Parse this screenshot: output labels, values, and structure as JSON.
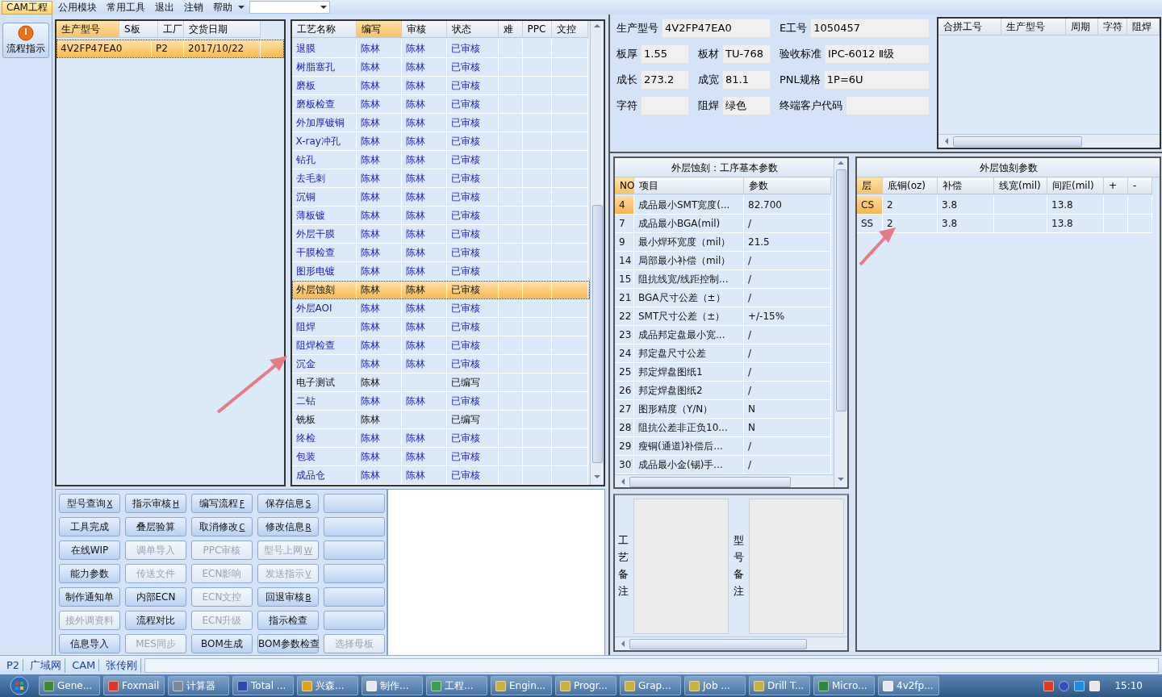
{
  "menu": {
    "items": [
      {
        "label": "CAM工程",
        "selected": true
      },
      {
        "label": "公用模块",
        "selected": false
      },
      {
        "label": "常用工具",
        "selected": false
      },
      {
        "label": "退出",
        "selected": false
      },
      {
        "label": "注销",
        "selected": false
      },
      {
        "label": "帮助",
        "selected": false
      }
    ]
  },
  "sidebar_button": {
    "label": "流程指示"
  },
  "orders": {
    "columns": [
      "生产型号",
      "S板",
      "工厂",
      "交货日期"
    ],
    "rows": [
      {
        "model": "4V2FP47EA0",
        "factory": "P2",
        "date": "2017/10/22",
        "selected": true
      }
    ]
  },
  "process": {
    "columns": [
      "工艺名称",
      "编写",
      "审核",
      "状态",
      "难",
      "PPC",
      "文控"
    ],
    "rows": [
      {
        "name": "退膜",
        "writer": "陈林",
        "reviewer": "陈林",
        "status": "已审核",
        "kind": "reviewed",
        "selected": false
      },
      {
        "name": "树脂塞孔",
        "writer": "陈林",
        "reviewer": "陈林",
        "status": "已审核",
        "kind": "reviewed",
        "selected": false
      },
      {
        "name": "磨板",
        "writer": "陈林",
        "reviewer": "陈林",
        "status": "已审核",
        "kind": "reviewed",
        "selected": false
      },
      {
        "name": "磨板检查",
        "writer": "陈林",
        "reviewer": "陈林",
        "status": "已审核",
        "kind": "reviewed",
        "selected": false
      },
      {
        "name": "外加厚镀铜",
        "writer": "陈林",
        "reviewer": "陈林",
        "status": "已审核",
        "kind": "reviewed",
        "selected": false
      },
      {
        "name": "X-ray冲孔",
        "writer": "陈林",
        "reviewer": "陈林",
        "status": "已审核",
        "kind": "reviewed",
        "selected": false
      },
      {
        "name": "钻孔",
        "writer": "陈林",
        "reviewer": "陈林",
        "status": "已审核",
        "kind": "reviewed",
        "selected": false
      },
      {
        "name": "去毛刺",
        "writer": "陈林",
        "reviewer": "陈林",
        "status": "已审核",
        "kind": "reviewed",
        "selected": false
      },
      {
        "name": "沉铜",
        "writer": "陈林",
        "reviewer": "陈林",
        "status": "已审核",
        "kind": "reviewed",
        "selected": false
      },
      {
        "name": "薄板镀",
        "writer": "陈林",
        "reviewer": "陈林",
        "status": "已审核",
        "kind": "reviewed",
        "selected": false
      },
      {
        "name": "外层干膜",
        "writer": "陈林",
        "reviewer": "陈林",
        "status": "已审核",
        "kind": "reviewed",
        "selected": false
      },
      {
        "name": "干膜检查",
        "writer": "陈林",
        "reviewer": "陈林",
        "status": "已审核",
        "kind": "reviewed",
        "selected": false
      },
      {
        "name": "图形电镀",
        "writer": "陈林",
        "reviewer": "陈林",
        "status": "已审核",
        "kind": "reviewed",
        "selected": false
      },
      {
        "name": "外层蚀刻",
        "writer": "陈林",
        "reviewer": "陈林",
        "status": "已审核",
        "kind": "reviewed",
        "selected": true
      },
      {
        "name": "外层AOI",
        "writer": "陈林",
        "reviewer": "陈林",
        "status": "已审核",
        "kind": "reviewed",
        "selected": false
      },
      {
        "name": "阻焊",
        "writer": "陈林",
        "reviewer": "陈林",
        "status": "已审核",
        "kind": "reviewed",
        "selected": false
      },
      {
        "name": "阻焊检查",
        "writer": "陈林",
        "reviewer": "陈林",
        "status": "已审核",
        "kind": "reviewed",
        "selected": false
      },
      {
        "name": "沉金",
        "writer": "陈林",
        "reviewer": "陈林",
        "status": "已审核",
        "kind": "reviewed",
        "selected": false
      },
      {
        "name": "电子测试",
        "writer": "陈林",
        "status": "已编写",
        "kind": "written",
        "selected": false
      },
      {
        "name": "二钻",
        "writer": "陈林",
        "reviewer": "陈林",
        "status": "已审核",
        "kind": "reviewed",
        "selected": false
      },
      {
        "name": "铣板",
        "writer": "陈林",
        "status": "已编写",
        "kind": "written",
        "selected": false
      },
      {
        "name": "终检",
        "writer": "陈林",
        "reviewer": "陈林",
        "status": "已审核",
        "kind": "reviewed",
        "selected": false
      },
      {
        "name": "包装",
        "writer": "陈林",
        "reviewer": "陈林",
        "status": "已审核",
        "kind": "reviewed",
        "selected": false
      },
      {
        "name": "成品仓",
        "writer": "陈林",
        "reviewer": "陈林",
        "status": "已审核",
        "kind": "reviewed",
        "selected": false
      }
    ]
  },
  "buttons": [
    {
      "label": "型号查询",
      "shortcut": "X",
      "disabled": false
    },
    {
      "label": "指示审核",
      "shortcut": "H",
      "disabled": false
    },
    {
      "label": "编写流程",
      "shortcut": "F",
      "disabled": false
    },
    {
      "label": "保存信息",
      "shortcut": "S",
      "disabled": false
    },
    {
      "disabled": false
    },
    {
      "label": "工具完成",
      "disabled": false
    },
    {
      "label": "叠层验算",
      "disabled": false
    },
    {
      "label": "取消修改",
      "shortcut": "C",
      "disabled": false
    },
    {
      "label": "修改信息",
      "shortcut": "R",
      "disabled": false
    },
    {
      "disabled": false
    },
    {
      "label": "在线WIP",
      "disabled": false
    },
    {
      "label": "调单导入",
      "disabled": true
    },
    {
      "label": "PPC审核",
      "disabled": true
    },
    {
      "label": "型号上网",
      "shortcut": "W",
      "disabled": true
    },
    {
      "disabled": false
    },
    {
      "label": "能力参数",
      "disabled": false
    },
    {
      "label": "传送文件",
      "disabled": true
    },
    {
      "label": "ECN影响",
      "disabled": true
    },
    {
      "label": "发送指示",
      "shortcut": "V",
      "disabled": true
    },
    {
      "disabled": false
    },
    {
      "label": "制作通知单",
      "disabled": false
    },
    {
      "label": "内部ECN",
      "disabled": false
    },
    {
      "label": "ECN文控",
      "disabled": true
    },
    {
      "label": "回退审核",
      "shortcut": "B",
      "disabled": false
    },
    {
      "disabled": false
    },
    {
      "label": "接外调资料",
      "disabled": true
    },
    {
      "label": "流程对比",
      "disabled": false
    },
    {
      "label": "ECN升级",
      "disabled": true
    },
    {
      "label": "指示检查",
      "disabled": false
    },
    {
      "disabled": false
    },
    {
      "label": "信息导入",
      "disabled": false
    },
    {
      "label": "MES同步",
      "disabled": true
    },
    {
      "label": "BOM生成",
      "disabled": false
    },
    {
      "label": "BOM参数检查",
      "disabled": false
    },
    {
      "label": "选择母板",
      "disabled": true
    }
  ],
  "info": {
    "header": {
      "model": {
        "label": "生产型号",
        "value": "4V2FP47EA0"
      },
      "job": {
        "label": "E工号",
        "value": "1050457"
      }
    },
    "rows": [
      [
        {
          "label": "板厚",
          "value": "1.55"
        },
        {
          "label": "板材",
          "value": "TU-768"
        },
        {
          "label": "验收标准",
          "value": "IPC-6012 Ⅱ级"
        }
      ],
      [
        {
          "label": "成长",
          "value": "273.2"
        },
        {
          "label": "成宽",
          "value": "81.1"
        },
        {
          "label": "PNL规格",
          "value": "1P=6U"
        }
      ],
      [
        {
          "label": "字符"
        },
        {
          "label": "阻焊",
          "value": "绿色"
        },
        {
          "label": "终端客户代码"
        }
      ]
    ]
  },
  "merge_table": {
    "columns": [
      "合拼工号",
      "生产型号",
      "周期",
      "字符",
      "阻焊"
    ]
  },
  "params": {
    "title": "外层蚀刻：工序基本参数",
    "columns": [
      "NO",
      "项目",
      "参数"
    ],
    "rows": [
      {
        "no": "4",
        "item": "成品最小SMT宽度(...",
        "value": "82.700",
        "selected": true
      },
      {
        "no": "7",
        "item": "成品最小BGA(mil)",
        "value": "/",
        "selected": false
      },
      {
        "no": "9",
        "item": "最小焊环宽度（mil）",
        "value": "21.5",
        "selected": false
      },
      {
        "no": "14",
        "item": "局部最小补偿（mil）",
        "value": "/",
        "selected": false
      },
      {
        "no": "15",
        "item": "阻抗线宽/线距控制...",
        "value": "/",
        "selected": false
      },
      {
        "no": "21",
        "item": "BGA尺寸公差（±）",
        "value": "/",
        "selected": false
      },
      {
        "no": "22",
        "item": "SMT尺寸公差（±）",
        "value": "+/-15%",
        "selected": false
      },
      {
        "no": "23",
        "item": "成品邦定盘最小宽...",
        "value": "/",
        "selected": false
      },
      {
        "no": "24",
        "item": "邦定盘尺寸公差",
        "value": "/",
        "selected": false
      },
      {
        "no": "25",
        "item": "邦定焊盘图纸1",
        "value": "/",
        "selected": false
      },
      {
        "no": "26",
        "item": "邦定焊盘图纸2",
        "value": "/",
        "selected": false
      },
      {
        "no": "27",
        "item": "图形精度（Y/N）",
        "value": "N",
        "selected": false
      },
      {
        "no": "28",
        "item": "阻抗公差非正负10...",
        "value": "N",
        "selected": false
      },
      {
        "no": "29",
        "item": "瘦铜(通道)补偿后...",
        "value": "/",
        "selected": false
      },
      {
        "no": "30",
        "item": "成品最小金(锡)手...",
        "value": "/",
        "selected": false
      }
    ]
  },
  "layers": {
    "title": "外层蚀刻参数",
    "columns": [
      "层",
      "底铜(oz)",
      "补偿",
      "线宽(mil)",
      "间距(mil)",
      "+",
      "-"
    ],
    "rows": [
      {
        "layer": "CS",
        "base": "2",
        "comp": "3.8",
        "space": "13.8",
        "selected": true
      },
      {
        "layer": "SS",
        "base": "2",
        "comp": "3.8",
        "space": "13.8",
        "selected": false
      }
    ]
  },
  "notes": [
    {
      "label": "工艺备注"
    },
    {
      "label": "型号备注"
    }
  ],
  "status_bar": {
    "factory": "P2",
    "items": [
      "广域网",
      "CAM",
      "张传刚"
    ]
  },
  "taskbar": {
    "items": [
      {
        "label": "Gene...",
        "color": "#3a8a3a"
      },
      {
        "label": "Foxmail",
        "color": "#d83a2a"
      },
      {
        "label": "计算器",
        "color": "#7a8a9a"
      },
      {
        "label": "Total ...",
        "color": "#2a4ab0"
      },
      {
        "label": "兴森...",
        "color": "#e0a020"
      },
      {
        "label": "制作...",
        "color": "#e8e8f0"
      },
      {
        "label": "工程...",
        "color": "#3aa050"
      },
      {
        "label": "Engin...",
        "color": "#c8b040"
      },
      {
        "label": "Progr...",
        "color": "#c8b040"
      },
      {
        "label": "Grap...",
        "color": "#c8b040"
      },
      {
        "label": "Job ...",
        "color": "#c8b040"
      },
      {
        "label": "Drill T...",
        "color": "#c8b040"
      },
      {
        "label": "Micro...",
        "color": "#2a8a40"
      },
      {
        "label": "4v2fp...",
        "color": "#e8e8f0"
      }
    ],
    "clock": "15:10"
  }
}
